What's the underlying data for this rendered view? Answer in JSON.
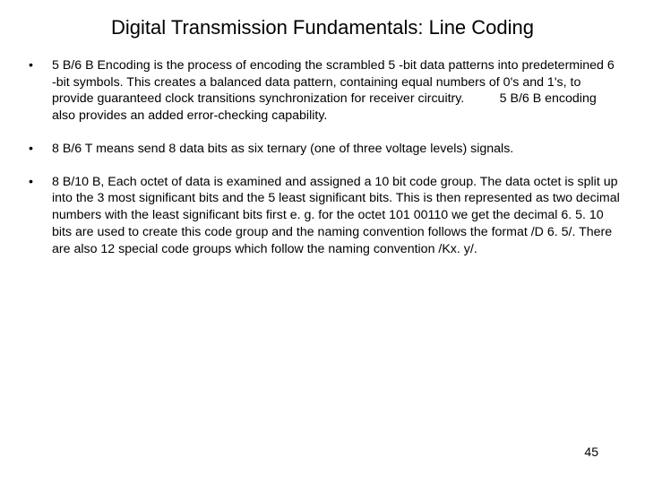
{
  "title": "Digital Transmission Fundamentals: Line Coding",
  "bullets": [
    "5 B/6 B Encoding is the process of encoding the scrambled 5 -bit data patterns into predetermined 6 -bit symbols. This creates a balanced data pattern, containing equal numbers of 0's and 1's, to provide guaranteed clock transitions synchronization for receiver circuitry.          5 B/6 B encoding also provides an added error-checking capability.",
    "8 B/6 T means send 8 data bits as six ternary (one of three voltage levels) signals.",
    "8 B/10 B, Each octet of data is examined and assigned a 10 bit code group. The data octet is split up into the 3 most significant bits and the 5 least significant bits. This is then represented as two decimal numbers with the least significant bits first e. g. for the octet 101 00110 we get the decimal 6. 5. 10 bits are used to create this code group and the naming convention follows the format /D 6. 5/. There are also 12 special code groups which follow the naming convention /Kx. y/."
  ],
  "bullet_marker": "•",
  "page_number": "45"
}
